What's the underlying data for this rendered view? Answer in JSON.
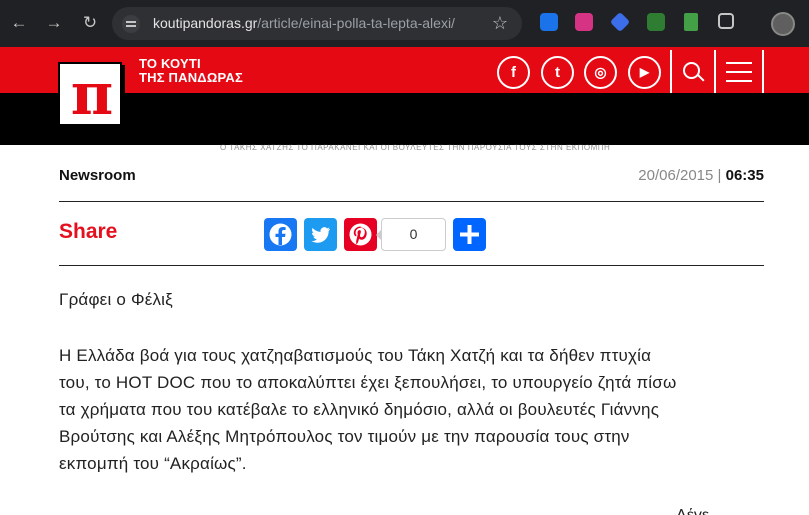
{
  "browser": {
    "url_host": "koutipandoras.gr",
    "url_path": "/article/einai-polla-ta-lepta-alexi/",
    "back_icon": "←",
    "forward_icon": "→",
    "reload_icon": "↻",
    "bookmark_icon": "☆"
  },
  "site": {
    "brand_line1": "ΤΟ ΚΟΥΤΙ",
    "brand_line2": "ΤΗΣ ΠΑΝΔΩΡΑΣ",
    "logo_glyph": "π",
    "social": {
      "facebook": "f",
      "twitter": "t",
      "instagram": "◎",
      "youtube": "▶"
    },
    "accent_color": "#e50914"
  },
  "article": {
    "faded_text": "Ο ΤΑΚΗΣ ΧΑΤΖΗΣ ΤΟ ΠΑΡΑΚΑΝΕΙ ΚΑΙ ΟΙ ΒΟΥΛΕΥΤΕΣ ΤΗΝ ΠΑΡΟΥΣΙΑ ΤΟΥΣ ΣΤΗΝ ΕΚΠΟΜΠΗ",
    "author": "Newsroom",
    "date": "20/06/2015",
    "date_sep": "|",
    "time": "06:35",
    "share_label": "Share",
    "share_count": "0",
    "byline": "Γράφει ο Φέλιξ",
    "body_lines": [
      "Η Ελλάδα βοά για τους χατζηαβατισμούς του Τάκη Χατζή και τα δήθεν πτυχία",
      "του, το HOT DOC που το αποκαλύπτει έχει ξεπουλήσει, το υπουργείο ζητά πίσω",
      "τα χρήματα που του κατέβαλε το ελληνικό δημόσιο, αλλά οι βουλευτές Γιάννης",
      "Βρούτσης και Αλέξης Μητρόπουλος τον τιμούν με την παρουσία τους στην",
      "εκπομπή του “Ακραίως”."
    ],
    "cut_text": "Λέγε"
  }
}
